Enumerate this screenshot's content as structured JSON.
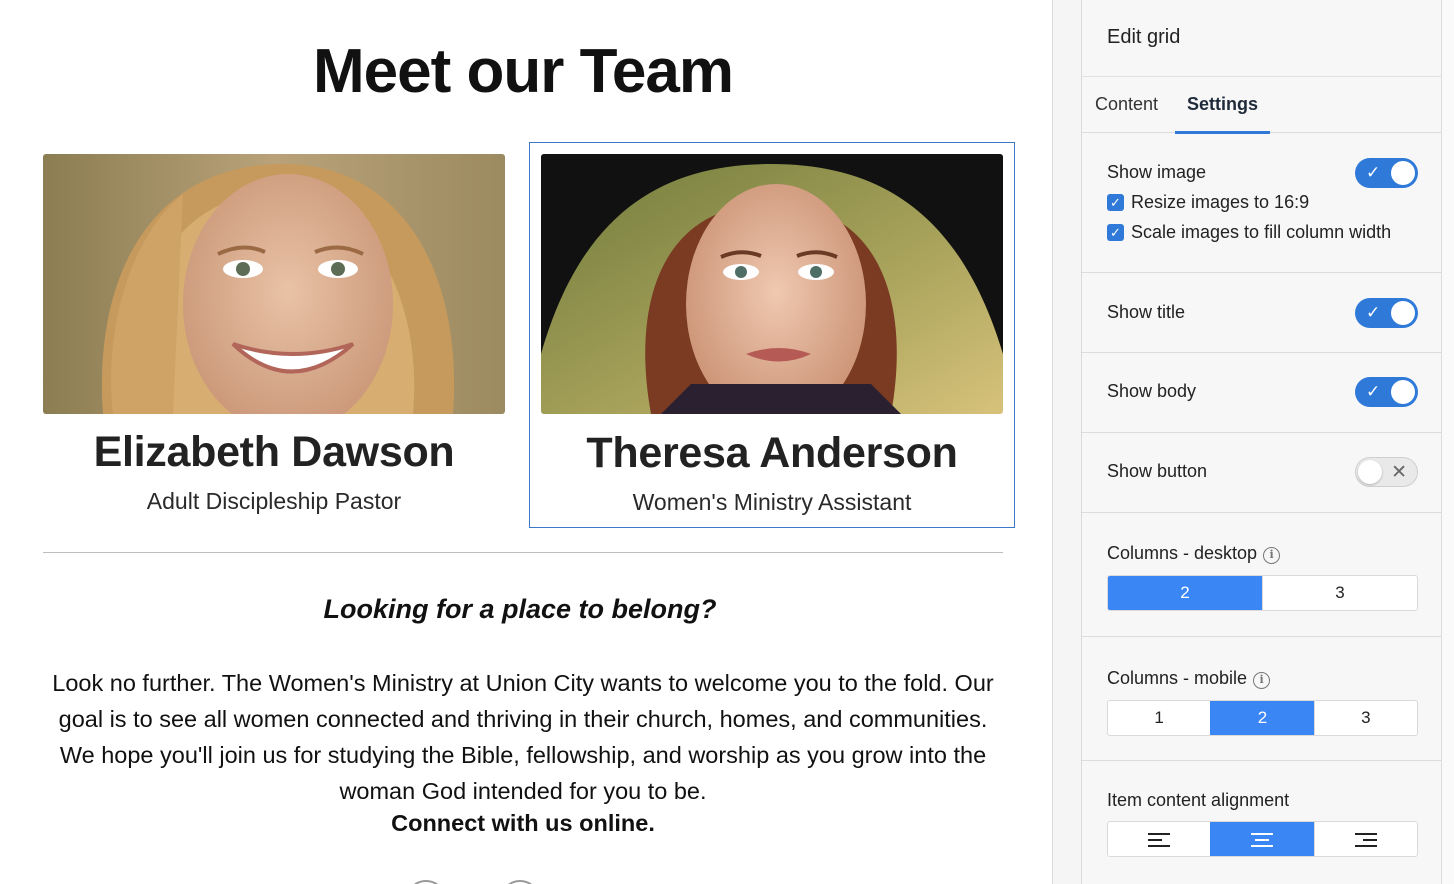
{
  "preview": {
    "title": "Meet our Team",
    "members": [
      {
        "name": "Elizabeth Dawson",
        "role": "Adult Discipleship Pastor"
      },
      {
        "name": "Theresa Anderson",
        "role": "Women's Ministry Assistant"
      }
    ],
    "tagline": "Looking for a place to belong?",
    "body": "Look no further. The Women's Ministry at Union City wants to welcome you to the fold. Our goal is to see all women connected and thriving in their church, homes, and communities. We hope you'll join us for studying the Bible, fellowship, and worship as you grow into the woman God intended for you to be.",
    "connect": "Connect with us online."
  },
  "panel": {
    "title": "Edit grid",
    "tabs": [
      "Content",
      "Settings"
    ],
    "active_tab": "Settings",
    "show_image": {
      "label": "Show image",
      "on": true
    },
    "resize_images": {
      "label": "Resize images to 16:9",
      "checked": true
    },
    "scale_images": {
      "label": "Scale images to fill column width",
      "checked": true
    },
    "show_title": {
      "label": "Show title",
      "on": true
    },
    "show_body": {
      "label": "Show body",
      "on": true
    },
    "show_button": {
      "label": "Show button",
      "on": false
    },
    "columns_desktop": {
      "label": "Columns - desktop",
      "options": [
        "2",
        "3"
      ],
      "selected": "2"
    },
    "columns_mobile": {
      "label": "Columns - mobile",
      "options": [
        "1",
        "2",
        "3"
      ],
      "selected": "2"
    },
    "alignment": {
      "label": "Item content alignment",
      "options": [
        "align-left-icon",
        "align-center-icon",
        "align-right-icon"
      ],
      "selected": "align-center-icon"
    }
  },
  "colors": {
    "accent": "#2f7ad8",
    "segment_active": "#3b86f5",
    "selected_card_border": "#3c78c8"
  }
}
